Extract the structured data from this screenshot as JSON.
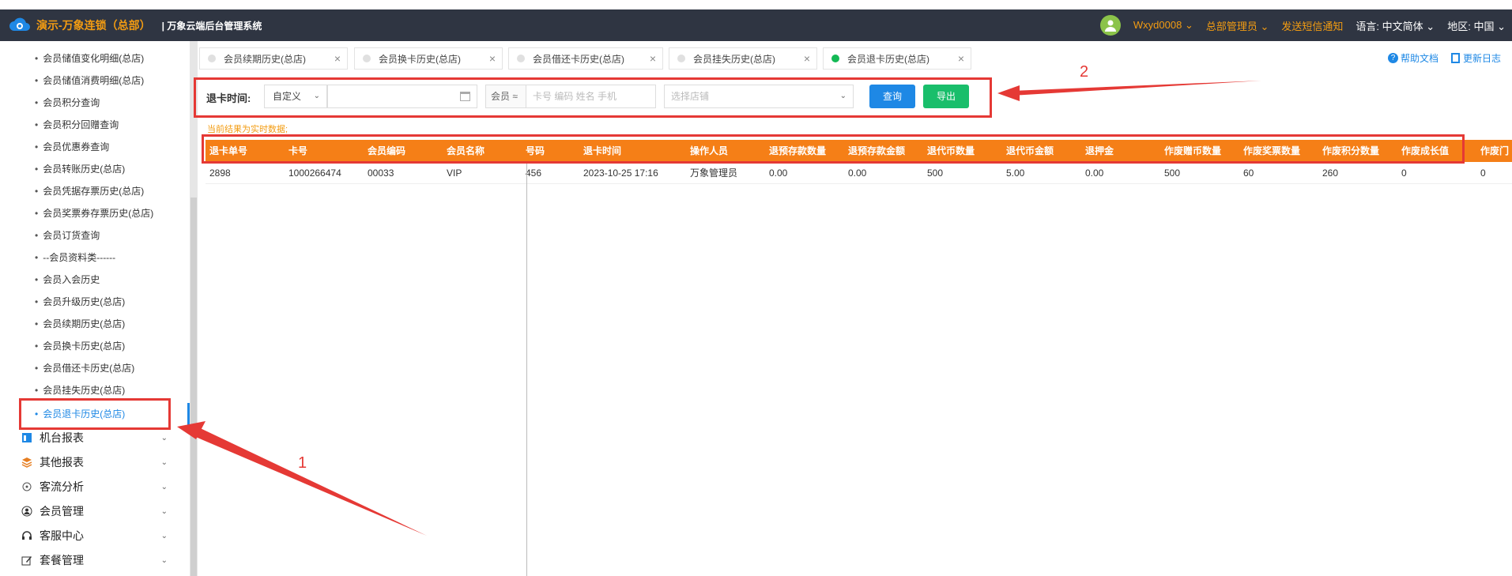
{
  "header": {
    "brand": "演示-万象连锁（总部）",
    "system": "| 万象云端后台管理系统",
    "user": "Wxyd0008",
    "role": "总部管理员",
    "sms": "发送短信通知",
    "lang_label": "语言:",
    "lang_value": "中文简体",
    "region_label": "地区:",
    "region_value": "中国"
  },
  "sidebar": {
    "items": [
      "会员储值变化明细(总店)",
      "会员储值消费明细(总店)",
      "会员积分查询",
      "会员积分回赠查询",
      "会员优惠券查询",
      "会员转账历史(总店)",
      "会员凭据存票历史(总店)",
      "会员奖票券存票历史(总店)",
      "会员订货查询",
      "--会员资料类------",
      "会员入会历史",
      "会员升级历史(总店)",
      "会员续期历史(总店)",
      "会员换卡历史(总店)",
      "会员借还卡历史(总店)",
      "会员挂失历史(总店)",
      "会员退卡历史(总店)"
    ],
    "groups": [
      {
        "label": "机台报表",
        "icon": "report-icon"
      },
      {
        "label": "其他报表",
        "icon": "stack-icon"
      },
      {
        "label": "客流分析",
        "icon": "target-icon"
      },
      {
        "label": "会员管理",
        "icon": "member-icon"
      },
      {
        "label": "客服中心",
        "icon": "headset-icon"
      },
      {
        "label": "套餐管理",
        "icon": "edit-icon"
      }
    ]
  },
  "tabs": [
    {
      "label": "会员续期历史(总店)",
      "active": false
    },
    {
      "label": "会员换卡历史(总店)",
      "active": false
    },
    {
      "label": "会员借还卡历史(总店)",
      "active": false
    },
    {
      "label": "会员挂失历史(总店)",
      "active": false
    },
    {
      "label": "会员退卡历史(总店)",
      "active": true
    }
  ],
  "toplinks": {
    "help": "帮助文档",
    "update": "更新日志"
  },
  "filter": {
    "label": "退卡时间:",
    "range_value": "自定义",
    "date_value": "",
    "member_prefix": "会员 ≈",
    "member_placeholder": "卡号 编码 姓名 手机",
    "shop_placeholder": "选择店铺",
    "query_button": "查询",
    "export_button": "导出"
  },
  "note": "当前结果为实时数据;",
  "table": {
    "columns": [
      "退卡单号",
      "卡号",
      "会员编码",
      "会员名称",
      "号码",
      "退卡时间",
      "操作人员",
      "退预存款数量",
      "退预存款金额",
      "退代币数量",
      "退代币金额",
      "退押金",
      "",
      "作废赠币数量",
      "作废奖票数量",
      "作废积分数量",
      "作废成长值",
      "作废门"
    ],
    "rows": [
      [
        "2898",
        "1000266474",
        "00033",
        "VIP",
        "456",
        "2023-10-25 17:16",
        "万象管理员",
        "0.00",
        "0.00",
        "500",
        "5.00",
        "0.00",
        "",
        "500",
        "60",
        "260",
        "0",
        "0"
      ]
    ]
  },
  "annotations": {
    "one": "1",
    "two": "2"
  },
  "colors": {
    "header_bg": "#2f3542",
    "brand": "#f39c12",
    "table_header": "#f57f17",
    "query_btn": "#1e88e5",
    "export_btn": "#19be6b",
    "annotation": "#e53935"
  }
}
